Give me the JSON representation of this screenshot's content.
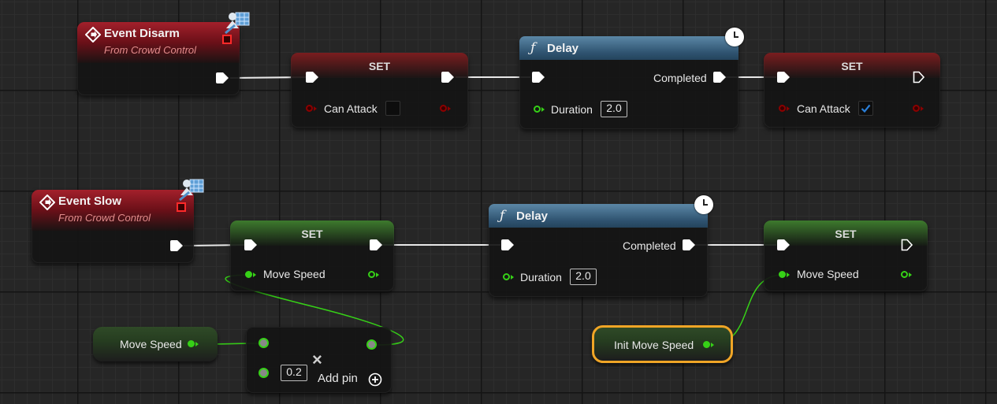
{
  "graph": {
    "event_disarm": {
      "title": "Event Disarm",
      "subtitle": "From Crowd Control"
    },
    "event_slow": {
      "title": "Event Slow",
      "subtitle": "From Crowd Control"
    },
    "set_can_attack_false": {
      "title": "SET",
      "var_label": "Can Attack",
      "value": false
    },
    "delay_1": {
      "title": "Delay",
      "completed_label": "Completed",
      "duration_label": "Duration",
      "duration_value": "2.0"
    },
    "set_can_attack_true": {
      "title": "SET",
      "var_label": "Can Attack",
      "value": true
    },
    "set_move_speed_1": {
      "title": "SET",
      "var_label": "Move Speed"
    },
    "delay_2": {
      "title": "Delay",
      "completed_label": "Completed",
      "duration_label": "Duration",
      "duration_value": "2.0"
    },
    "set_move_speed_2": {
      "title": "SET",
      "var_label": "Move Speed"
    },
    "get_move_speed": {
      "label": "Move Speed"
    },
    "multiply": {
      "operator": "×",
      "value": "0.2",
      "add_pin_label": "Add pin"
    },
    "get_init_move_speed": {
      "label": "Init Move Speed"
    }
  },
  "colors": {
    "exec": "#ffffff",
    "bool_pin": "#8c0000",
    "float_pin": "#36d117",
    "event_header": "#a3202b",
    "function_header": "#4d7694",
    "set_red_header": "#7a1d1f",
    "set_green_header": "#3d7a2d",
    "selected_outline": "#f0a526",
    "checkbox_check": "#2a7fd8"
  },
  "icons": [
    "event-diamond-icon",
    "network-replicate-icon",
    "function-f-icon",
    "latent-clock-icon",
    "add-pin-plus-icon",
    "multiply-x-icon",
    "checkmark-icon"
  ]
}
